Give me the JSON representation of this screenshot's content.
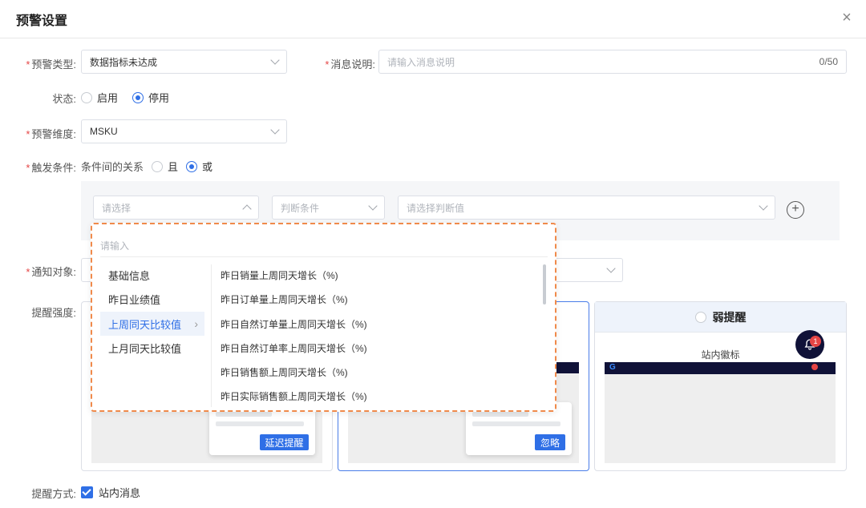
{
  "dialog": {
    "title": "预警设置"
  },
  "form": {
    "alert_type": {
      "label": "预警类型:",
      "value": "数据指标未达成"
    },
    "message": {
      "label": "消息说明:",
      "placeholder": "请输入消息说明",
      "counter": "0/50"
    },
    "status": {
      "label": "状态:",
      "options": [
        "启用",
        "停用"
      ],
      "selected": "停用"
    },
    "dimension": {
      "label": "预警维度:",
      "value": "MSKU"
    },
    "trigger": {
      "label": "触发条件:",
      "relation_label": "条件间的关系",
      "options": [
        "且",
        "或"
      ],
      "selected": "或"
    },
    "condition": {
      "field_placeholder": "请选择",
      "judge_placeholder": "判断条件",
      "value_placeholder": "请选择判断值"
    },
    "notify": {
      "label": "通知对象:"
    },
    "strength": {
      "label": "提醒强度:"
    },
    "method": {
      "label": "提醒方式:",
      "option": "站内消息"
    }
  },
  "dropdown": {
    "search_placeholder": "请输入",
    "categories": [
      "基础信息",
      "昨日业绩值",
      "上周同天比较值",
      "上月同天比较值"
    ],
    "active_category": "上周同天比较值",
    "items": [
      "昨日销量上周同天增长（%)",
      "昨日订单量上周同天增长（%)",
      "昨日自然订单量上周同天增长（%)",
      "昨日自然订单率上周同天增长（%)",
      "昨日销售额上周同天增长（%)",
      "昨日实际销售额上周同天增长（%)"
    ]
  },
  "cards": {
    "weak": {
      "title": "弱提醒",
      "subtitle": "站内徽标",
      "bell_count": "1"
    },
    "delay_button": "延迟提醒",
    "ignore_button": "忽略"
  },
  "colors": {
    "primary": "#2f6fe6",
    "required": "#e54545",
    "highlight_border": "#f08a4b"
  }
}
